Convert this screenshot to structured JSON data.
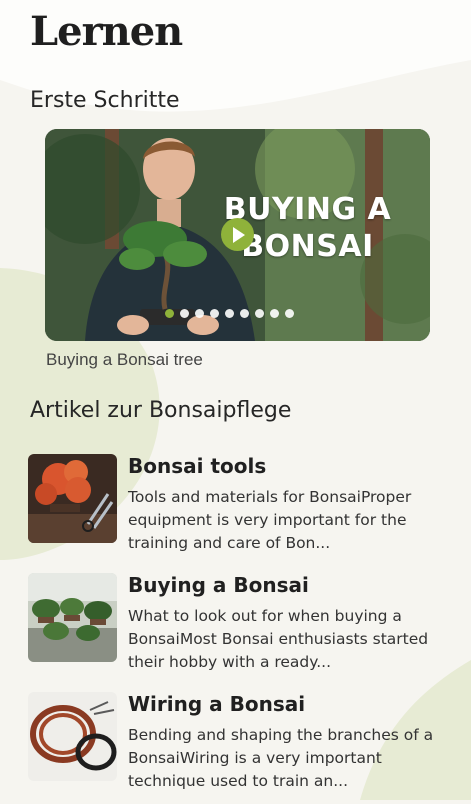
{
  "page": {
    "title": "Lernen",
    "accent_color": "#8fb23a",
    "background_color": "#f6f5f0"
  },
  "first_steps": {
    "heading": "Erste Schritte",
    "video": {
      "overlay_text_line1": "BUYING A",
      "overlay_text_line2": "BONSAI",
      "caption": "Buying a Bonsai tree",
      "play_icon": "play-icon",
      "carousel": {
        "total": 9,
        "active_index": 0
      }
    }
  },
  "articles_section": {
    "heading": "Artikel zur Bonsaipflege",
    "items": [
      {
        "title": "Bonsai tools",
        "description": "Tools and materials for BonsaiProper equipment is very important for the training and care of Bon...",
        "thumbnail": "bonsai-tools-thumbnail"
      },
      {
        "title": "Buying a Bonsai",
        "description": "What to look out for when buying a BonsaiMost Bonsai enthusiasts started their hobby with a ready...",
        "thumbnail": "bonsai-nursery-thumbnail"
      },
      {
        "title": "Wiring a Bonsai",
        "description": "Bending and shaping the branches of a BonsaiWiring is a very important technique used to train an...",
        "thumbnail": "bonsai-wire-thumbnail"
      }
    ]
  }
}
